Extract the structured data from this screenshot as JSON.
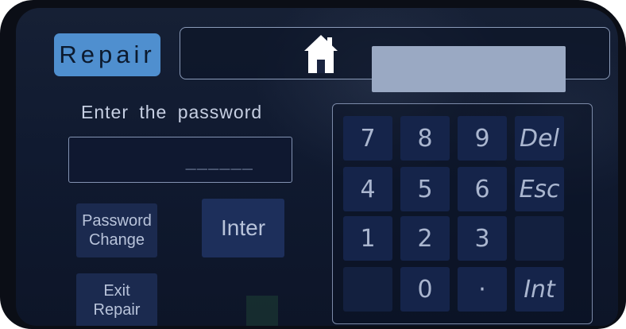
{
  "header": {
    "repair_tab": "Repair",
    "home_icon": "home-icon",
    "display_value": ""
  },
  "login": {
    "prompt": "Enter the password",
    "password_value": "______",
    "password_change_line1": "Password",
    "password_change_line2": "Change",
    "enter_button": "Inter",
    "exit_line1": "Exit",
    "exit_line2": "Repair"
  },
  "keypad": {
    "keys": [
      "7",
      "8",
      "9",
      "Del",
      "4",
      "5",
      "6",
      "Esc",
      "1",
      "2",
      "3",
      "",
      "",
      "0",
      "·",
      "Int"
    ]
  },
  "colors": {
    "screen_background": "#101a30",
    "repair_tab": "#4f8fcf",
    "key_background": "#15244a",
    "text": "#b8c3da"
  }
}
